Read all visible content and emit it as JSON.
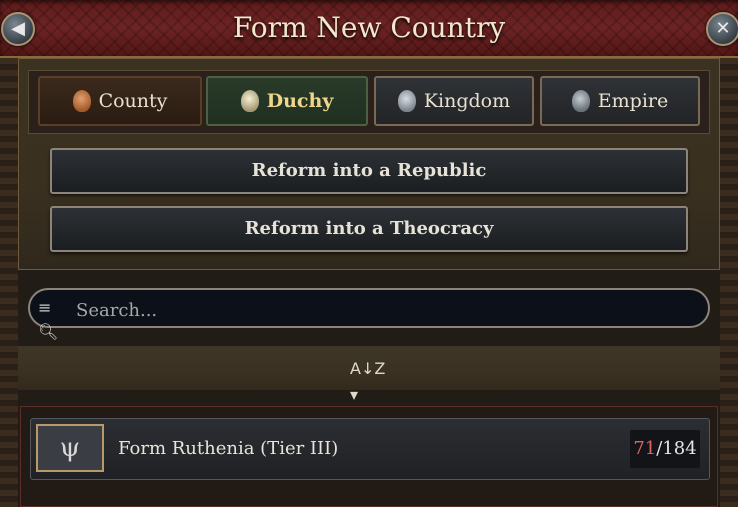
{
  "header": {
    "title": "Form New Country",
    "back_icon": "arrow-left-icon",
    "close_icon": "close-icon"
  },
  "tiers": [
    {
      "label": "County",
      "icon": "county-tier-icon",
      "state": "default"
    },
    {
      "label": "Duchy",
      "icon": "duchy-tier-icon",
      "state": "selected"
    },
    {
      "label": "Kingdom",
      "icon": "kingdom-tier-icon",
      "state": "default"
    },
    {
      "label": "Empire",
      "icon": "empire-tier-icon",
      "state": "default"
    }
  ],
  "actions": {
    "reform_republic": "Reform into a Republic",
    "reform_theocracy": "Reform into a Theocracy"
  },
  "search": {
    "placeholder": "Search...",
    "value": ""
  },
  "sort": {
    "icon": "sort-az-icon"
  },
  "list": [
    {
      "label": "Form Ruthenia (Tier III)",
      "emblem": "trident-emblem-icon",
      "progress_current": "71",
      "progress_total": "/184"
    }
  ],
  "colors": {
    "header_red": "#6d2323",
    "selected_tab_text": "#f0d68a",
    "progress_current": "#e06464"
  }
}
